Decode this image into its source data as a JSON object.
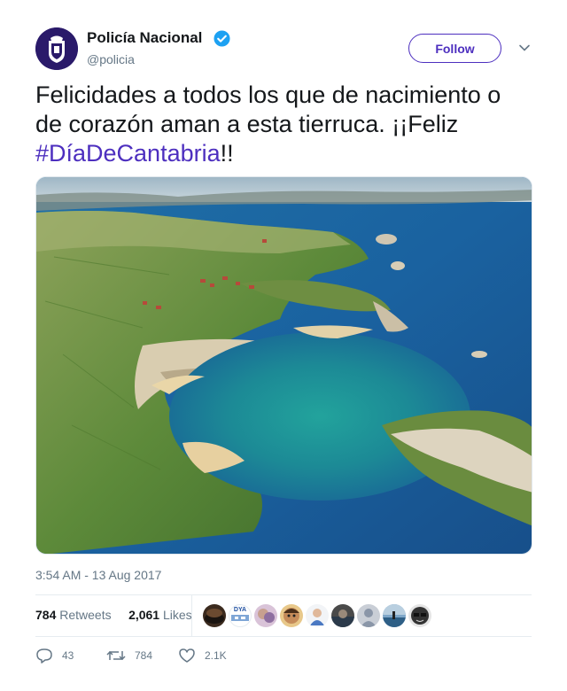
{
  "account": {
    "display_name": "Policía Nacional",
    "handle": "@policia",
    "verified": true,
    "avatar_icon": "policia-emblem-icon"
  },
  "follow_label": "Follow",
  "tweet": {
    "text_before": "Felicidades a todos los que de nacimiento o de corazón aman a esta tierruca.  ¡¡Feliz ",
    "hashtag": "#DíaDeCantabria",
    "text_after": "!!",
    "photo_icon": "coastline-photo"
  },
  "timestamp": "3:54 AM - 13 Aug 2017",
  "stats": {
    "retweets_count": "784",
    "retweets_label": "Retweets",
    "likes_count": "2,061",
    "likes_label": "Likes"
  },
  "liker_avatars_badge": "DYA",
  "actions": {
    "replies": "43",
    "retweets": "784",
    "likes": "2.1K"
  },
  "colors": {
    "accent": "#4d2fbf",
    "verified": "#1da1f2",
    "muted": "#657786"
  }
}
